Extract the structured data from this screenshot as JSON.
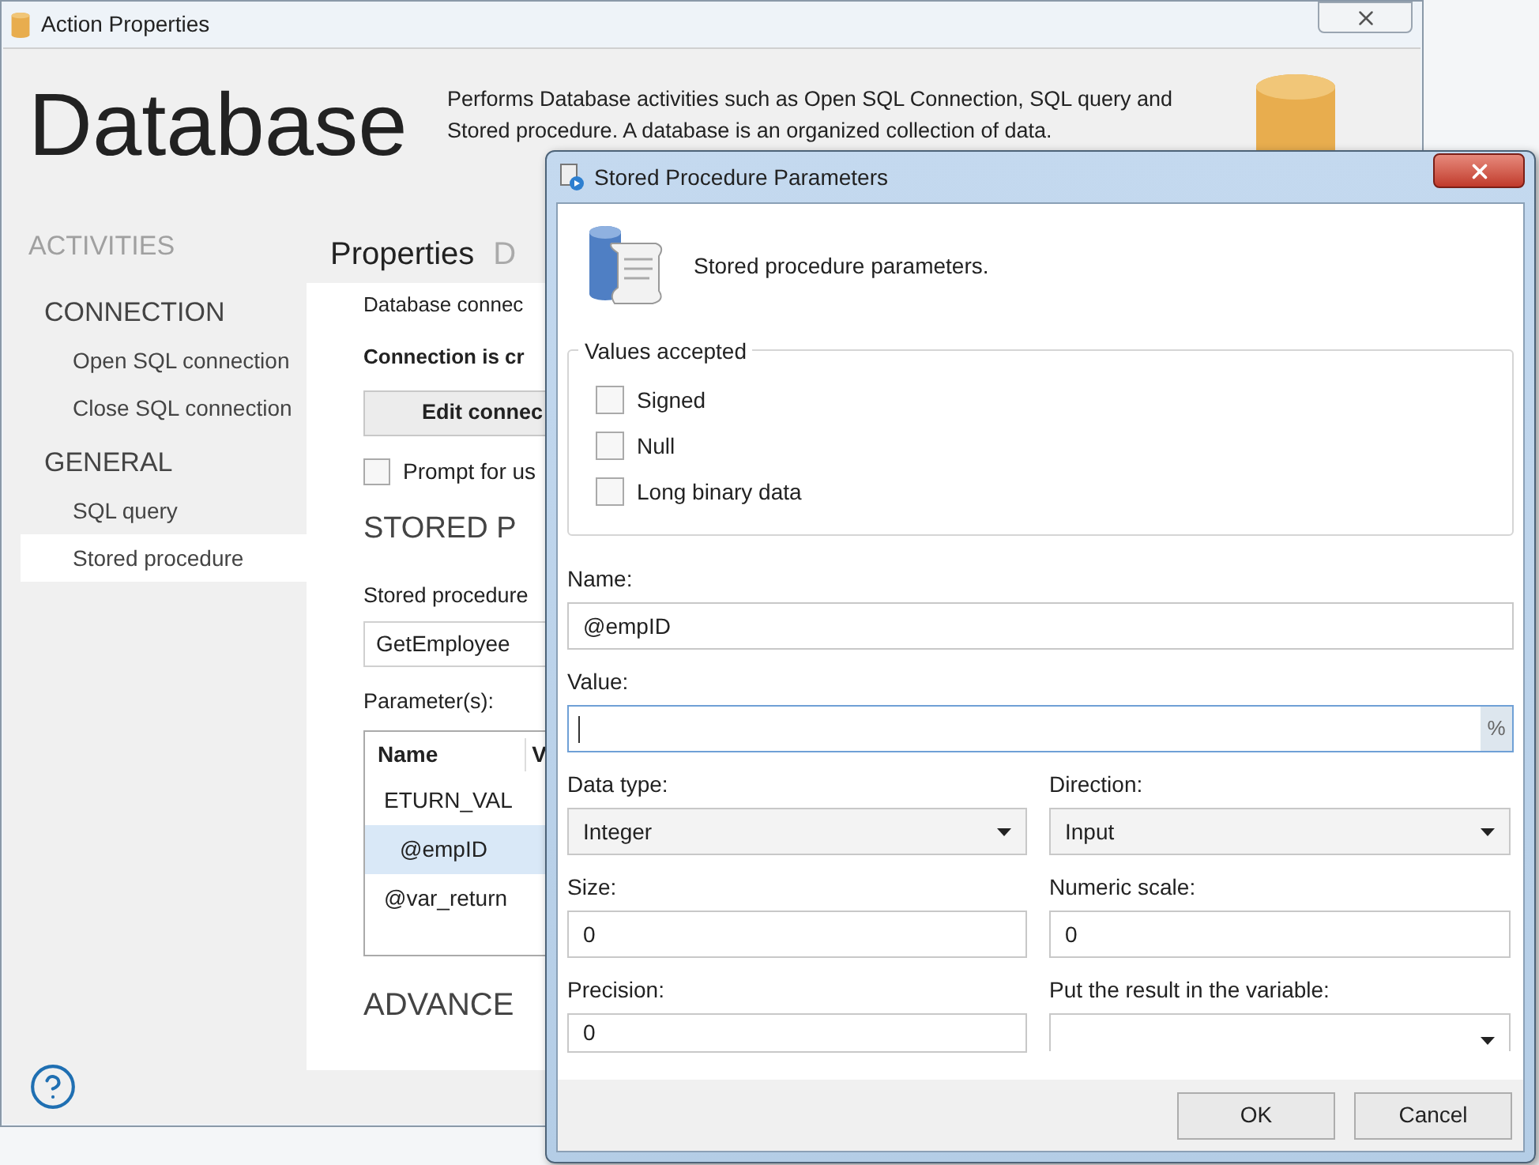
{
  "main_window": {
    "title": "Action Properties",
    "heading": "Database",
    "description": "Performs Database activities such as Open SQL Connection, SQL query and Stored procedure. A database is an organized collection of data.",
    "sidebar": {
      "title": "ACTIVITIES",
      "groups": [
        {
          "label": "CONNECTION",
          "items": [
            {
              "label": "Open SQL connection",
              "selected": false
            },
            {
              "label": "Close SQL connection",
              "selected": false
            }
          ]
        },
        {
          "label": "GENERAL",
          "items": [
            {
              "label": "SQL query",
              "selected": false
            },
            {
              "label": "Stored procedure",
              "selected": true
            }
          ]
        }
      ]
    },
    "tabs": [
      {
        "label": "Properties",
        "selected": true
      },
      {
        "label": "D",
        "selected": false
      }
    ],
    "properties": {
      "connection_label": "Database connec",
      "connection_status": "Connection is cr",
      "edit_button": "Edit connec",
      "prompt_checkbox": {
        "label": "Prompt for us",
        "checked": false
      },
      "section_title": "STORED P",
      "procedure_label": "Stored procedure",
      "procedure_field": {
        "value": "GetEmployee"
      },
      "parameters_label": "Parameter(s):",
      "parameters_table": {
        "columns": [
          "Name",
          "V"
        ],
        "rows": [
          {
            "name": "ETURN_VAL",
            "selected": false
          },
          {
            "name": "@empID",
            "selected": true
          },
          {
            "name": "@var_return",
            "selected": false
          }
        ]
      },
      "advanced_title": "ADVANCE"
    }
  },
  "dialog": {
    "title": "Stored Procedure Parameters",
    "header_text": "Stored procedure parameters.",
    "values_group": {
      "title": "Values accepted",
      "options": [
        {
          "label": "Signed",
          "checked": false
        },
        {
          "label": "Null",
          "checked": false
        },
        {
          "label": "Long binary data",
          "checked": false
        }
      ]
    },
    "name": {
      "label": "Name:",
      "value": "@empID"
    },
    "value": {
      "label": "Value:",
      "suffix": "%"
    },
    "data_type": {
      "label": "Data type:",
      "value": "Integer"
    },
    "direction": {
      "label": "Direction:",
      "value": "Input"
    },
    "size": {
      "label": "Size:",
      "value": "0"
    },
    "numeric_scale": {
      "label": "Numeric scale:",
      "value": "0"
    },
    "precision": {
      "label": "Precision:",
      "value": "0"
    },
    "result_variable": {
      "label": "Put the result in the variable:"
    },
    "buttons": [
      "OK",
      "Cancel"
    ]
  }
}
